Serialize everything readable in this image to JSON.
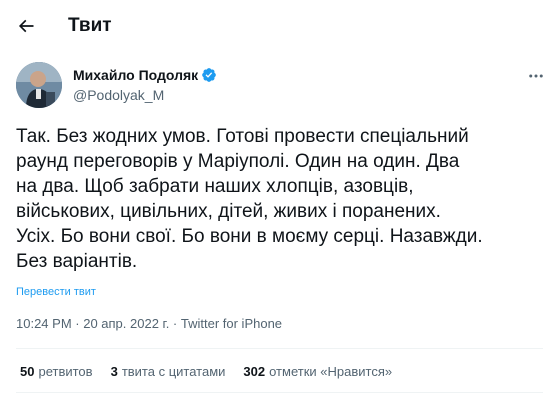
{
  "header": {
    "title": "Твит"
  },
  "tweet": {
    "author_name": "Михайло Подоляк",
    "handle": "@Podolyak_M",
    "text": "Так. Без жодних умов. Готові провести спеціальний\nраунд переговорів у Маріуполі. Один на один. Два\nна два. Щоб забрати наших хлопців, азовців,\nвійськових, цивільних, дітей, живих і поранених.\nУсіх. Бо вони свої. Бо вони в моєму серці. Назавжди.\nБез варіантів.",
    "translate_label": "Перевести твит",
    "time": "10:24 PM",
    "separator": " · ",
    "date": "20 апр. 2022 г.",
    "source": "Twitter for iPhone"
  },
  "stats": {
    "retweets_count": "50",
    "retweets_label": "ретвитов",
    "quotes_count": "3",
    "quotes_label": "твита с цитатами",
    "likes_count": "302",
    "likes_label": "отметки «Нравится»"
  },
  "colors": {
    "text": "#0f1419",
    "secondary": "#536471",
    "accent": "#1d9bf0",
    "divider": "#eff3f4"
  },
  "icons": {
    "back": "arrow-left-icon",
    "verified": "verified-badge-icon",
    "more": "more-horizontal-icon"
  }
}
